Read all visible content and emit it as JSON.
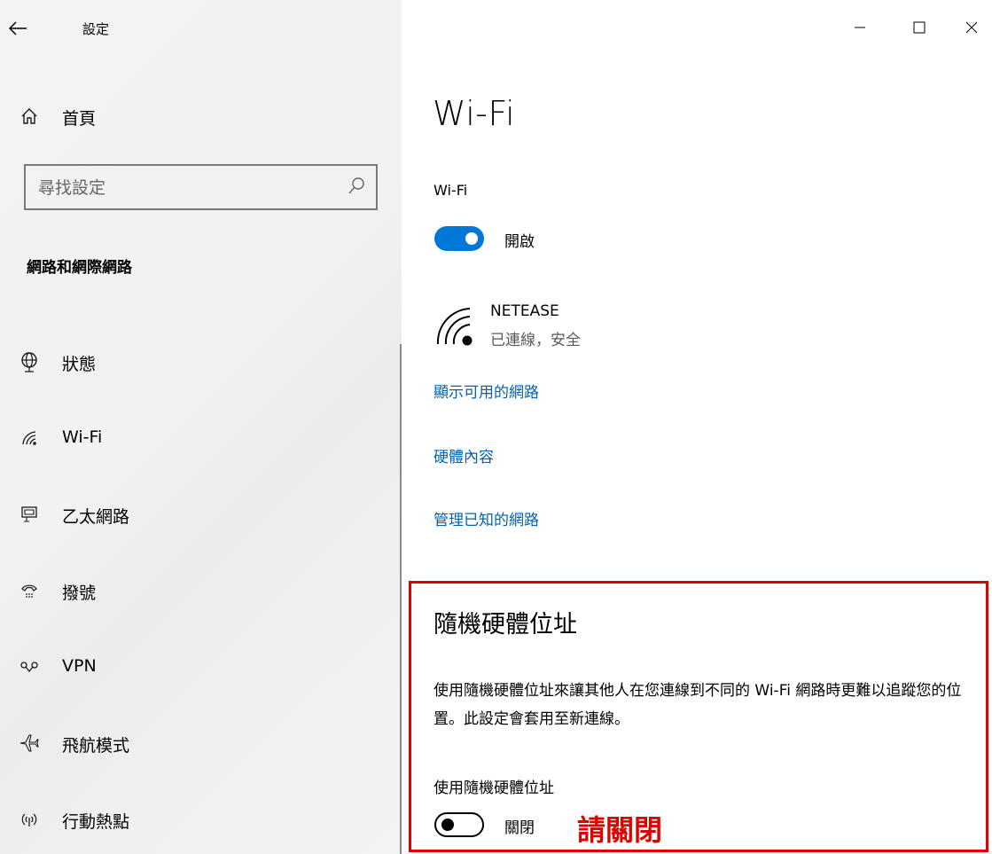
{
  "window": {
    "title": "設定",
    "minimize_glyph": "—",
    "maximize_glyph": "□",
    "close_glyph": "X"
  },
  "sidebar": {
    "home_label": "首頁",
    "search_placeholder": "尋找設定",
    "section_header": "網路和網際網路",
    "items": [
      {
        "label": "狀態",
        "icon": "globe-icon"
      },
      {
        "label": "Wi-Fi",
        "icon": "wifi-icon"
      },
      {
        "label": "乙太網路",
        "icon": "ethernet-icon"
      },
      {
        "label": "撥號",
        "icon": "dialup-icon"
      },
      {
        "label": "VPN",
        "icon": "vpn-icon"
      },
      {
        "label": "飛航模式",
        "icon": "airplane-icon"
      },
      {
        "label": "行動熱點",
        "icon": "hotspot-icon"
      }
    ]
  },
  "main": {
    "title": "Wi-Fi",
    "wifi_label": "Wi-Fi",
    "wifi_toggle_state": "開啟",
    "network": {
      "name": "NETEASE",
      "status": "已連線，安全"
    },
    "links": [
      "顯示可用的網路",
      "硬體內容",
      "管理已知的網路"
    ],
    "random_hw": {
      "title": "隨機硬體位址",
      "description": "使用隨機硬體位址來讓其他人在您連線到不同的 Wi-Fi 網路時更難以追蹤您的位置。此設定會套用至新連線。",
      "toggle_label": "使用隨機硬體位址",
      "toggle_state": "關閉",
      "annotation": "請關閉"
    }
  },
  "colors": {
    "accent": "#0078d7",
    "link": "#0063b1",
    "highlight": "#e00000"
  }
}
